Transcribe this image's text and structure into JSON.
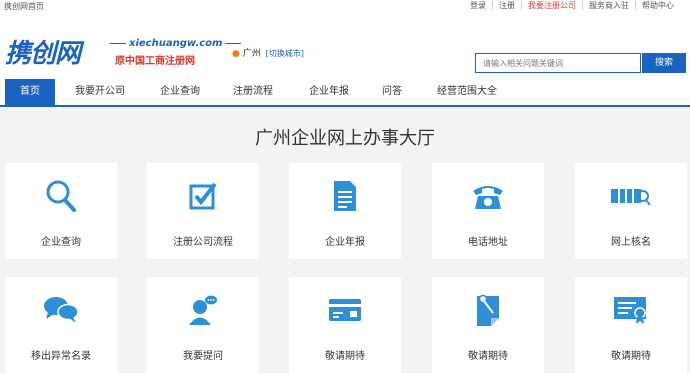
{
  "topbar": {
    "home_label": "携创网首页",
    "links": [
      "登录",
      "注册",
      "我要注册公司",
      "服务商入驻",
      "帮助中心"
    ]
  },
  "header": {
    "logo_text": "携创网",
    "site_url": "xiechuangw.com",
    "tagline": "原中国工商注册网",
    "city": "广州",
    "city_switch": "[切换城市]"
  },
  "search": {
    "placeholder": "请输入相关问题关键词",
    "button": "搜索"
  },
  "nav": {
    "items": [
      "首页",
      "我要开公司",
      "企业查询",
      "注册流程",
      "企业年报",
      "问答",
      "经营范围大全"
    ]
  },
  "main": {
    "title": "广州企业网上办事大厅",
    "cards": [
      {
        "label": "企业查询",
        "icon": "search-icon"
      },
      {
        "label": "注册公司流程",
        "icon": "checkbox-icon"
      },
      {
        "label": "企业年报",
        "icon": "document-icon"
      },
      {
        "label": "电话地址",
        "icon": "telephone-icon"
      },
      {
        "label": "网上核名",
        "icon": "name-check-icon"
      },
      {
        "label": "移出异常名录",
        "icon": "chat-bubbles-icon"
      },
      {
        "label": "我要提问",
        "icon": "person-question-icon"
      },
      {
        "label": "敬请期待",
        "icon": "card-icon"
      },
      {
        "label": "敬请期待",
        "icon": "note-icon"
      },
      {
        "label": "敬请期待",
        "icon": "certificate-icon"
      }
    ]
  },
  "colors": {
    "brand": "#1b63c0",
    "icon": "#2c8fd8",
    "highlight": "#e0432c"
  }
}
